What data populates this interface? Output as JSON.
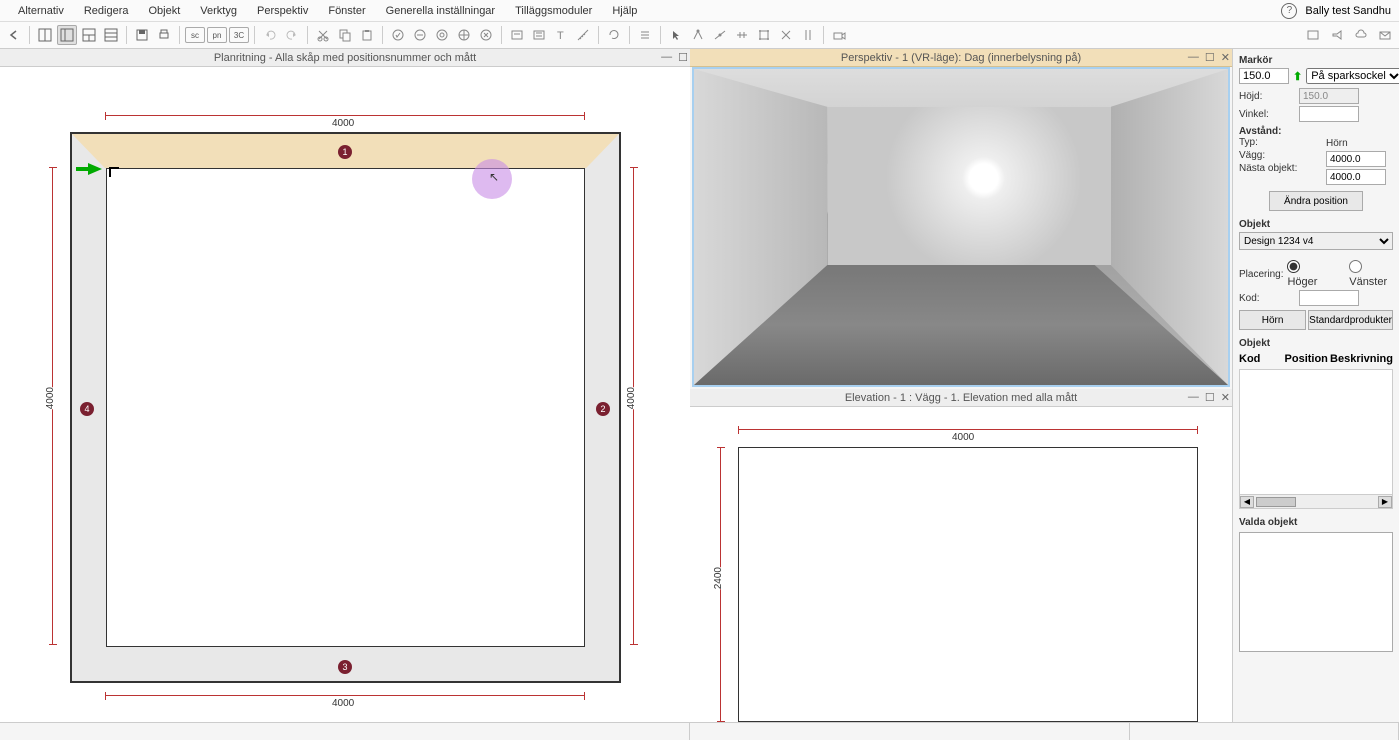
{
  "menu": {
    "items": [
      "Alternativ",
      "Redigera",
      "Objekt",
      "Verktyg",
      "Perspektiv",
      "Fönster",
      "Generella inställningar",
      "Tilläggsmoduler",
      "Hjälp"
    ],
    "user": "Bally test  Sandhu"
  },
  "toolbar": {
    "labels": {
      "sc": "sc",
      "pn": "pn",
      "3C": "3C"
    }
  },
  "windows": {
    "plan_title": "Planritning - Alla skåp med positionsnummer och mått",
    "persp_title": "Perspektiv - 1 (VR-läge): Dag (innerbelysning på)",
    "elev_title": "Elevation - 1 : Vägg - 1. Elevation med alla mått"
  },
  "plan": {
    "dim_top": "4000",
    "dim_bottom": "4000",
    "dim_left": "4000",
    "dim_right": "4000",
    "wall_nums": [
      "1",
      "2",
      "3",
      "4"
    ]
  },
  "elevation": {
    "dim_w": "4000",
    "dim_h": "2400"
  },
  "panel": {
    "markor": {
      "title": "Markör",
      "value": "150.0",
      "socket_label": "På sparksockel",
      "hojd_label": "Höjd:",
      "hojd_value": "150.0",
      "vinkel_label": "Vinkel:",
      "avstand_label": "Avstånd:",
      "typ_label": "Typ:",
      "horn_label": "Hörn",
      "vagg_label": "Vägg:",
      "vagg_value": "4000.0",
      "nasta_label": "Nästa objekt:",
      "nasta_value": "4000.0",
      "andra_pos": "Ändra position"
    },
    "objekt": {
      "title": "Objekt",
      "selected": "Design 1234 v4",
      "placering_label": "Placering:",
      "hoger": "Höger",
      "vanster": "Vänster",
      "kod_label": "Kod:",
      "horn_btn": "Hörn",
      "std_btn": "Standardprodukter",
      "list_title": "Objekt",
      "col_kod": "Kod",
      "col_pos": "Position",
      "col_besk": "Beskrivning"
    },
    "valda": {
      "title": "Valda objekt"
    }
  }
}
